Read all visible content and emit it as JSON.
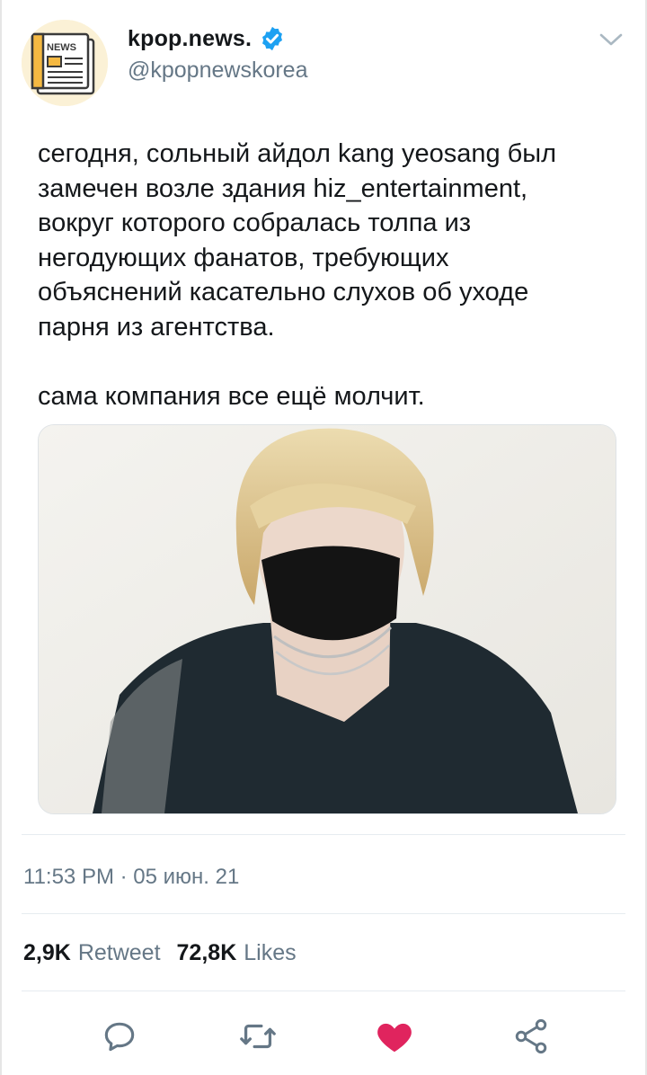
{
  "account": {
    "display_name": "kpop.news.",
    "handle": "@kpopnewskorea",
    "avatar_badge": "NEWS",
    "verified": true
  },
  "tweet": {
    "text": "сегодня, сольный айдол kang yeosang был\nзамечен возле здания hiz_entertainment,\nвокруг которого собралась толпа из\nнегодующих фанатов, требующих\nобъяснений касательно слухов об уходе\nпарня из агентства.\n\nсама компания все ещё молчит.",
    "timestamp": "11:53 PM · 05 июн. 21"
  },
  "stats": {
    "retweets_count": "2,9K",
    "retweets_label": "Retweet",
    "likes_count": "72,8K",
    "likes_label": "Likes"
  },
  "actions": [
    {
      "name": "reply-icon"
    },
    {
      "name": "retweet-icon"
    },
    {
      "name": "like-icon",
      "color": "#e0245e",
      "active": true
    },
    {
      "name": "share-icon"
    }
  ],
  "colors": {
    "verified": "#1da1f2",
    "secondary_text": "#657786",
    "like_active": "#e0245e",
    "action_icon": "#657786"
  }
}
